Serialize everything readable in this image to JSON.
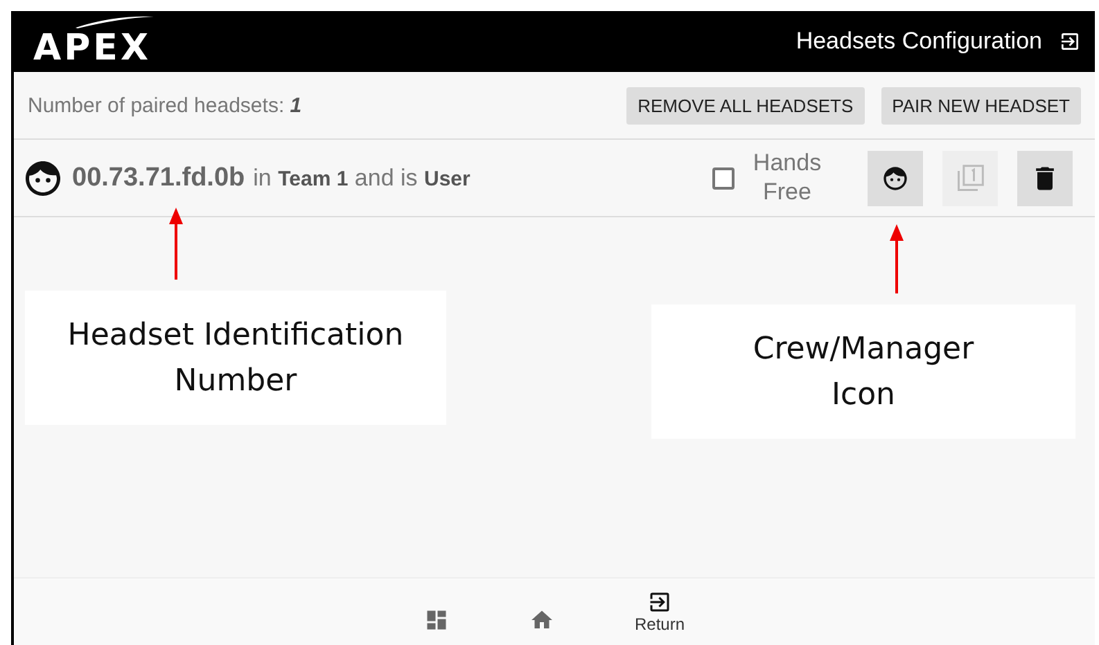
{
  "app_bar": {
    "logo": "APEX",
    "title": "Headsets Configuration"
  },
  "toolbar": {
    "count_label": "Number of paired headsets:",
    "count": "1",
    "buttons": [
      "REMOVE ALL HEADSETS",
      "PAIR NEW HEADSET"
    ]
  },
  "headsets": [
    {
      "id": "00.73.71.fd.0b",
      "text": "in **Team 1** and is **User**",
      "hands_free": {
        "label": "Hands Free",
        "checked": false
      },
      "actions": [
        {
          "kind": "crew",
          "disabled": false
        },
        {
          "kind": "team",
          "disabled": true
        },
        {
          "kind": "delete",
          "disabled": false
        }
      ]
    }
  ],
  "bottom_nav": [
    {
      "kind": "dashboard"
    },
    {
      "kind": "home"
    },
    {
      "kind": "return",
      "label": "Return"
    }
  ],
  "annotations": [
    {
      "text": "Headset Identification Number",
      "kind": "id"
    },
    {
      "text": "Crew/Manager Icon",
      "kind": "crew"
    }
  ]
}
